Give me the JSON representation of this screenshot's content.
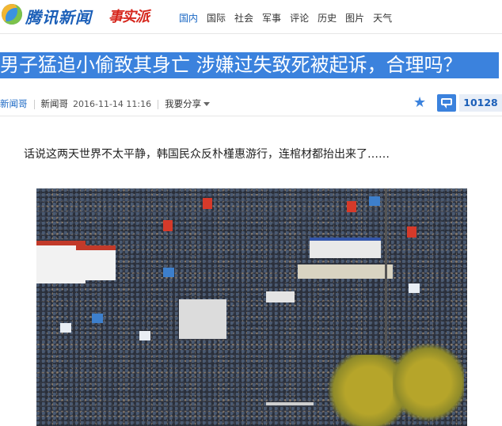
{
  "header": {
    "logo_text": "腾讯新闻",
    "brand_badge": "事实派",
    "nav": [
      {
        "label": "国内",
        "active": true
      },
      {
        "label": "国际",
        "active": false
      },
      {
        "label": "社会",
        "active": false
      },
      {
        "label": "军事",
        "active": false
      },
      {
        "label": "评论",
        "active": false
      },
      {
        "label": "历史",
        "active": false
      },
      {
        "label": "图片",
        "active": false
      },
      {
        "label": "天气",
        "active": false
      }
    ]
  },
  "article": {
    "title": "男子猛追小偷致其身亡 涉嫌过失致死被起诉，合理吗？",
    "source": "新闻哥",
    "author": "新闻哥",
    "time": "2016-11-14 11:16",
    "share_label": "我要分享",
    "comment_count": "10128",
    "intro": "话说这两天世界不太平静，韩国民众反朴槿惠游行，连棺材都抬出来了……"
  },
  "icons": {
    "favorite": "star-icon",
    "comment": "comment-icon"
  },
  "colors": {
    "accent": "#3b82dd",
    "headline_bg": "#3b82dd",
    "nav_active": "#1b68c4",
    "brand_red": "#d6261c"
  }
}
